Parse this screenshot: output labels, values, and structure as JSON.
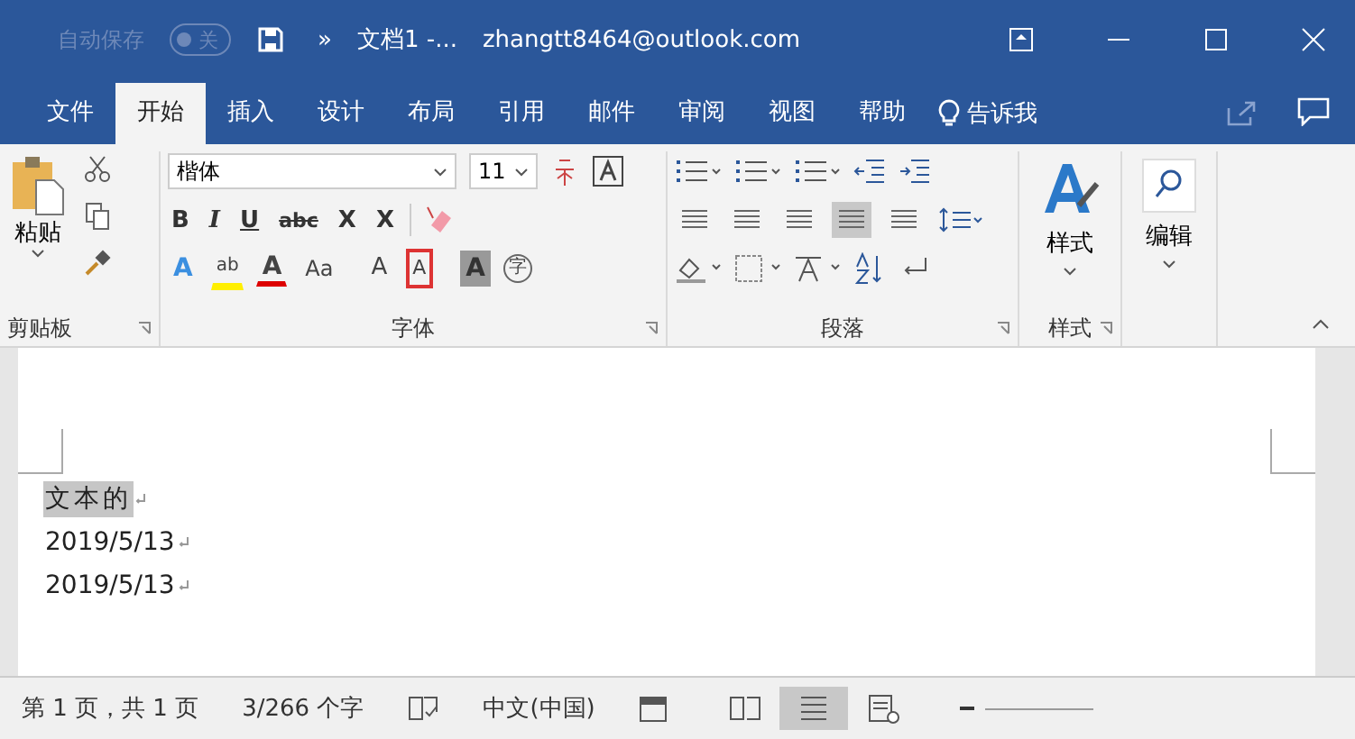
{
  "title_bar": {
    "autosave_label": "自动保存",
    "autosave_toggle": {
      "label": "关",
      "on": false
    },
    "overflow": "»",
    "doc_title": "文档1  -...",
    "account": "zhangtt8464@outlook.com"
  },
  "tabs": [
    {
      "label": "文件",
      "selected": false
    },
    {
      "label": "开始",
      "selected": true
    },
    {
      "label": "插入",
      "selected": false
    },
    {
      "label": "设计",
      "selected": false
    },
    {
      "label": "布局",
      "selected": false
    },
    {
      "label": "引用",
      "selected": false
    },
    {
      "label": "邮件",
      "selected": false
    },
    {
      "label": "审阅",
      "selected": false
    },
    {
      "label": "视图",
      "selected": false
    },
    {
      "label": "帮助",
      "selected": false
    }
  ],
  "tell_me": "告诉我",
  "clipboard": {
    "paste_label": "粘贴",
    "group_label": "剪贴板"
  },
  "font": {
    "font_name": "楷体",
    "font_size": "11",
    "format_buttons": [
      {
        "label": "B",
        "kind": "bold"
      },
      {
        "label": "I",
        "kind": "italic"
      },
      {
        "label": "U",
        "kind": "underline"
      },
      {
        "label": "abc",
        "kind": "strike"
      },
      {
        "label": "X",
        "kind": "sub"
      },
      {
        "label": "X",
        "kind": "sup"
      }
    ],
    "effect_buttons": [
      {
        "label": "A",
        "kind": "effects",
        "marked": false
      },
      {
        "label": "ab",
        "kind": "highlight",
        "marked": false
      },
      {
        "label": "A",
        "kind": "color",
        "marked": false
      },
      {
        "label": "Aa",
        "kind": "case",
        "marked": false
      },
      {
        "label": "A",
        "kind": "grow",
        "marked": false
      },
      {
        "label": "A",
        "kind": "shrink",
        "marked": true
      },
      {
        "label": "A",
        "kind": "shade",
        "marked": false
      },
      {
        "label": "字",
        "kind": "enclose",
        "marked": false
      }
    ],
    "group_label": "字体"
  },
  "paragraph": {
    "alignments": [
      {
        "selected": false
      },
      {
        "selected": false
      },
      {
        "selected": false
      },
      {
        "selected": true
      },
      {
        "selected": false
      }
    ],
    "group_label": "段落"
  },
  "styles": {
    "label": "样式",
    "group_label": "样式"
  },
  "editing": {
    "label": "编辑"
  },
  "document": {
    "lines": [
      {
        "text": "文本的",
        "highlighted": true
      },
      {
        "text": "2019/5/13",
        "highlighted": false
      },
      {
        "text": "2019/5/13",
        "highlighted": false
      }
    ]
  },
  "status_bar": {
    "page": "第 1 页，共 1 页",
    "words": "3/266 个字",
    "language": "中文(中国)",
    "views": [
      {
        "kind": "read",
        "selected": false
      },
      {
        "kind": "print",
        "selected": true
      },
      {
        "kind": "web",
        "selected": false
      }
    ]
  }
}
